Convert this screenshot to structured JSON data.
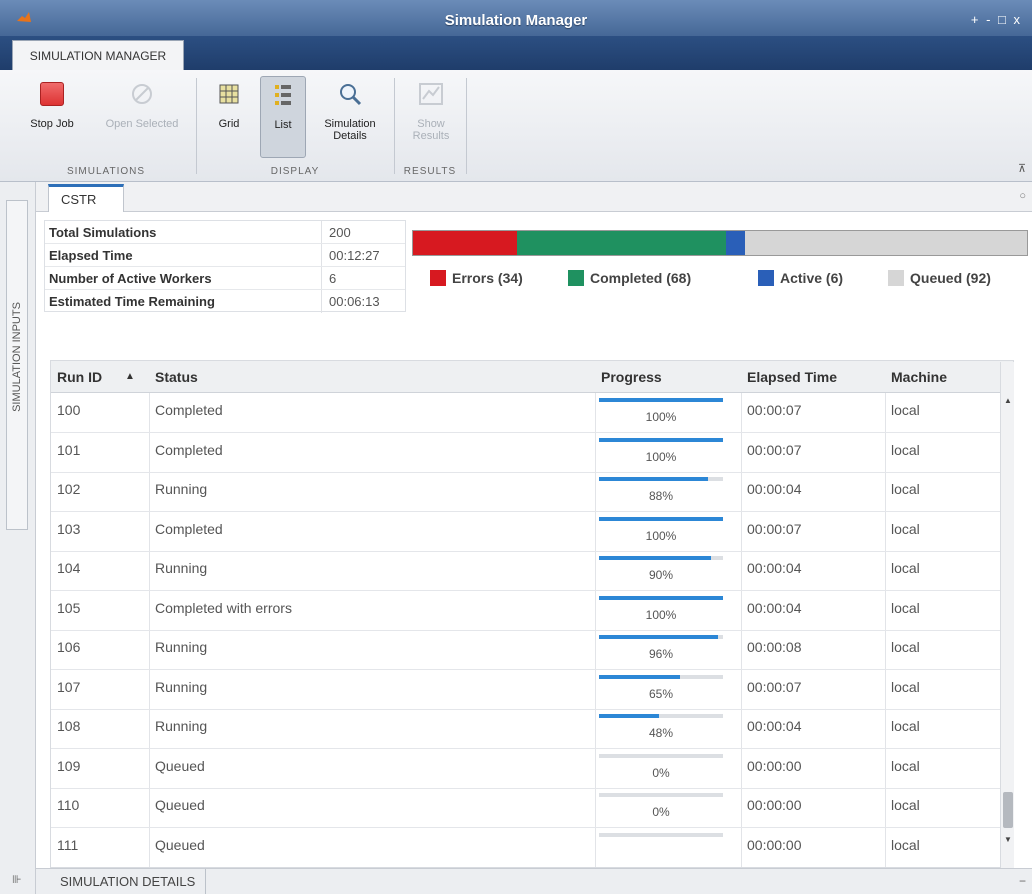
{
  "window": {
    "title": "Simulation Manager",
    "controls": "+ - □ x"
  },
  "tabs": {
    "main": "SIMULATION MANAGER"
  },
  "toolstrip": {
    "stop_job": "Stop Job",
    "open_selected": "Open Selected",
    "grid": "Grid",
    "list": "List",
    "simulation_details": "Simulation Details",
    "show_results": "Show Results",
    "group_simulations": "SIMULATIONS",
    "group_display": "DISPLAY",
    "group_results": "RESULTS"
  },
  "left_rail": {
    "simulation_inputs": "SIMULATION INPUTS"
  },
  "doc_tab": {
    "label": "CSTR"
  },
  "stats": {
    "total_label": "Total Simulations",
    "total_value": "200",
    "elapsed_label": "Elapsed Time",
    "elapsed_value": "00:12:27",
    "workers_label": "Number of Active Workers",
    "workers_value": "6",
    "remaining_label": "Estimated Time Remaining",
    "remaining_value": "00:06:13"
  },
  "status_summary": {
    "errors": 34,
    "completed": 68,
    "active": 6,
    "queued": 92,
    "errors_label": "Errors (34)",
    "completed_label": "Completed (68)",
    "active_label": "Active (6)",
    "queued_label": "Queued (92)",
    "colors": {
      "errors": "#d71920",
      "completed": "#1f9160",
      "active": "#2a5fb8",
      "queued": "#d6d6d6"
    }
  },
  "table": {
    "headers": {
      "run_id": "Run ID",
      "sort_icon": "▲",
      "status": "Status",
      "progress": "Progress",
      "elapsed": "Elapsed Time",
      "machine": "Machine"
    },
    "rows": [
      {
        "run_id": "100",
        "status": "Completed",
        "progress": 100,
        "progress_text": "100%",
        "elapsed": "00:00:07",
        "machine": "local"
      },
      {
        "run_id": "101",
        "status": "Completed",
        "progress": 100,
        "progress_text": "100%",
        "elapsed": "00:00:07",
        "machine": "local"
      },
      {
        "run_id": "102",
        "status": "Running",
        "progress": 88,
        "progress_text": "88%",
        "elapsed": "00:00:04",
        "machine": "local"
      },
      {
        "run_id": "103",
        "status": "Completed",
        "progress": 100,
        "progress_text": "100%",
        "elapsed": "00:00:07",
        "machine": "local"
      },
      {
        "run_id": "104",
        "status": "Running",
        "progress": 90,
        "progress_text": "90%",
        "elapsed": "00:00:04",
        "machine": "local"
      },
      {
        "run_id": "105",
        "status": "Completed with errors",
        "progress": 100,
        "progress_text": "100%",
        "elapsed": "00:00:04",
        "machine": "local"
      },
      {
        "run_id": "106",
        "status": "Running",
        "progress": 96,
        "progress_text": "96%",
        "elapsed": "00:00:08",
        "machine": "local"
      },
      {
        "run_id": "107",
        "status": "Running",
        "progress": 65,
        "progress_text": "65%",
        "elapsed": "00:00:07",
        "machine": "local"
      },
      {
        "run_id": "108",
        "status": "Running",
        "progress": 48,
        "progress_text": "48%",
        "elapsed": "00:00:04",
        "machine": "local"
      },
      {
        "run_id": "109",
        "status": "Queued",
        "progress": 0,
        "progress_text": "0%",
        "elapsed": "00:00:00",
        "machine": "local"
      },
      {
        "run_id": "110",
        "status": "Queued",
        "progress": 0,
        "progress_text": "0%",
        "elapsed": "00:00:00",
        "machine": "local"
      },
      {
        "run_id": "111",
        "status": "Queued",
        "progress": 0,
        "progress_text": "",
        "elapsed": "00:00:00",
        "machine": "local"
      }
    ]
  },
  "bottom": {
    "simulation_details": "SIMULATION DETAILS"
  }
}
